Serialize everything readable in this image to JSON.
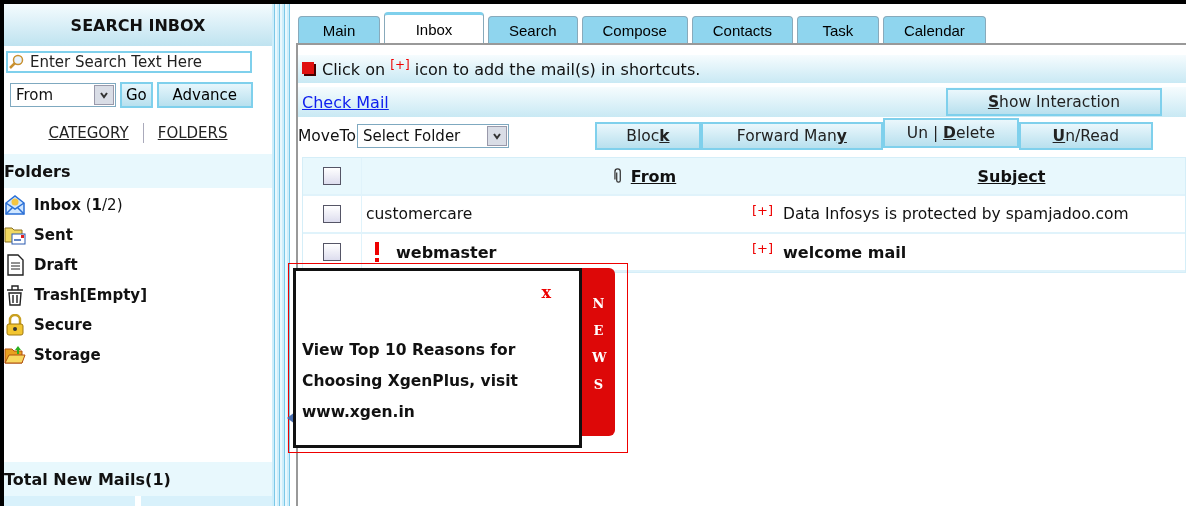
{
  "sidebar": {
    "title": "SEARCH INBOX",
    "search": {
      "placeholder": "Enter Search Text Here"
    },
    "field_select": "From",
    "go_button": "Go",
    "advance_button": "Advance",
    "links": [
      "CATEGORY",
      "FOLDERS"
    ],
    "folders_heading": "Folders",
    "folders": [
      {
        "kind": "inbox",
        "label": "**Inbox** (**1**/2)"
      },
      {
        "kind": "sent",
        "label": "Sent"
      },
      {
        "kind": "draft",
        "label": "Draft"
      },
      {
        "kind": "trash",
        "label": "Trash[Empty]"
      },
      {
        "kind": "secure",
        "label": "Secure"
      },
      {
        "kind": "storage",
        "label": "Storage"
      }
    ],
    "total_new": "Total New Mails(1)"
  },
  "tabs": [
    {
      "label": "Main",
      "selected": false
    },
    {
      "label": "Inbox",
      "selected": true
    },
    {
      "label": "Search",
      "selected": false
    },
    {
      "label": "Compose",
      "selected": false
    },
    {
      "label": "Contacts",
      "selected": false
    },
    {
      "label": "Task",
      "selected": false
    },
    {
      "label": "Calendar",
      "selected": false
    }
  ],
  "info": "Click on $^{[+]}$ icon to add the mail(s) in shortcuts.",
  "check_mail": "Check Mail",
  "show_interaction": "**S**how Interaction",
  "move_to": {
    "label": "MoveTo",
    "select": "Select Folder"
  },
  "actions": [
    "Bloc**k**",
    "Forward Man**y**",
    "Un | **D**elete",
    "**U**n/Read"
  ],
  "table": {
    "select_all": false,
    "columns": [
      "From",
      "Subject"
    ],
    "rows": [
      {
        "checked": false,
        "important": false,
        "unread": false,
        "from": "customercare",
        "shortcut": "[+]",
        "subject": "Data Infosys is protected by spamjadoo.com"
      },
      {
        "checked": false,
        "important": true,
        "unread": true,
        "from": "webmaster",
        "shortcut": "[+]",
        "subject": "welcome mail"
      }
    ]
  },
  "news_popup": {
    "close": "x",
    "message": "View Top 10 Reasons for Choosing XgenPlus, visit www.xgen.in",
    "tab": "NEWS"
  }
}
